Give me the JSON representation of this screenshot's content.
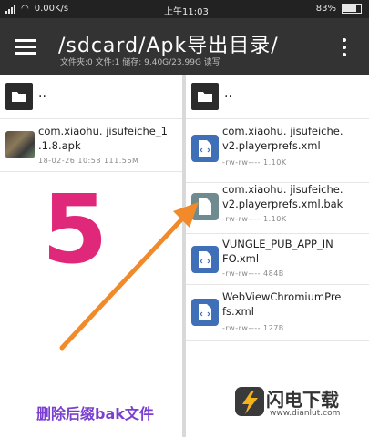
{
  "status_bar": {
    "network_speed": "0.00K/s",
    "time": "上午11:03",
    "battery": "83%"
  },
  "toolbar": {
    "title": "/sdcard/Apk导出目录/",
    "subtitle": "文件夹:0 文件:1 储存: 9.40G/23.99G 读写"
  },
  "left_pane": {
    "parent_label": "..",
    "files": [
      {
        "name": "com.xiaohu. jisufeiche_1 .1.8.apk",
        "meta": "18-02-26 10:58  111.56M"
      }
    ]
  },
  "right_pane": {
    "parent_label": "..",
    "files": [
      {
        "name": "com.xiaohu. jisufeiche. v2.playerprefs.xml",
        "meta": "-rw-rw----  1.10K",
        "icon": "xml-file-icon",
        "color": "#3f6fb6"
      },
      {
        "name": "com.xiaohu. jisufeiche. v2.playerprefs.xml.bak",
        "meta": "-rw-rw----  1.10K",
        "icon": "file-icon",
        "color": "#6f8b8f"
      },
      {
        "name": "VUNGLE_PUB_APP_IN FO.xml",
        "meta": "-rw-rw----  484B",
        "icon": "xml-file-icon",
        "color": "#3f6fb6"
      },
      {
        "name": "WebViewChromiumPre fs.xml",
        "meta": "-rw-rw----  127B",
        "icon": "xml-file-icon",
        "color": "#3f6fb6"
      }
    ]
  },
  "annotation": {
    "step_number": "5",
    "caption": "删除后缀bak文件",
    "color_number": "#e0287a",
    "color_arrow": "#f08a2a",
    "color_caption": "#7a3fd0"
  },
  "watermark": {
    "brand": "闪电下载",
    "url": "www.dianlut.com"
  }
}
